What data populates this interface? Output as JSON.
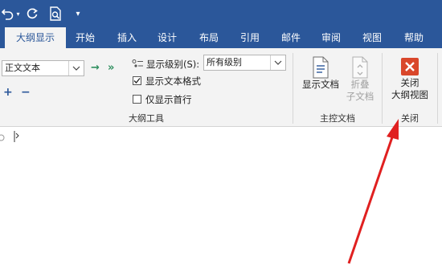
{
  "quick_access": {
    "undo_icon": "undo-icon",
    "redo_icon": "redo-icon",
    "print_preview_icon": "print-preview-icon",
    "customize_icon": "customize-qat-icon"
  },
  "tabs": [
    {
      "label": "大纲显示",
      "active": true
    },
    {
      "label": "开始"
    },
    {
      "label": "插入"
    },
    {
      "label": "设计"
    },
    {
      "label": "布局"
    },
    {
      "label": "引用"
    },
    {
      "label": "邮件"
    },
    {
      "label": "审阅"
    },
    {
      "label": "视图"
    },
    {
      "label": "帮助"
    }
  ],
  "outline_tools": {
    "level_select_value": "正文文本",
    "show_level_label": "显示级别(S):",
    "show_level_value": "所有级别",
    "show_text_format_label": "显示文本格式",
    "show_text_format_checked": true,
    "show_first_line_only_label": "仅显示首行",
    "show_first_line_only_checked": false,
    "group_label": "大纲工具"
  },
  "master_document": {
    "show_document_label": "显示文档",
    "collapse_subdocs_line1": "折叠",
    "collapse_subdocs_line2": "子文档",
    "group_label": "主控文档"
  },
  "close_group": {
    "close_outline_line1": "关闭",
    "close_outline_line2": "大纲视图",
    "group_label": "关闭"
  },
  "colors": {
    "ribbon_blue": "#2b579a",
    "close_red": "#d9472b",
    "annotation_arrow": "#e02020"
  }
}
